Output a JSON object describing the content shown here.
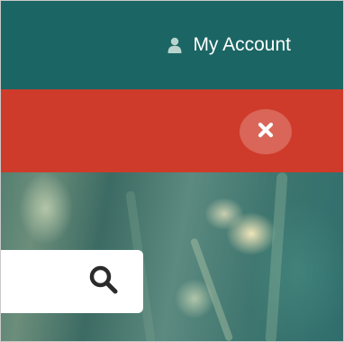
{
  "header": {
    "account_label": "My Account",
    "account_icon": "user-icon"
  },
  "alert": {
    "close_icon": "close-icon"
  },
  "search": {
    "value": "",
    "icon": "search-icon"
  },
  "colors": {
    "header_bg": "#1b6664",
    "alert_bg": "#cf3b2a",
    "text": "#ffffff"
  }
}
